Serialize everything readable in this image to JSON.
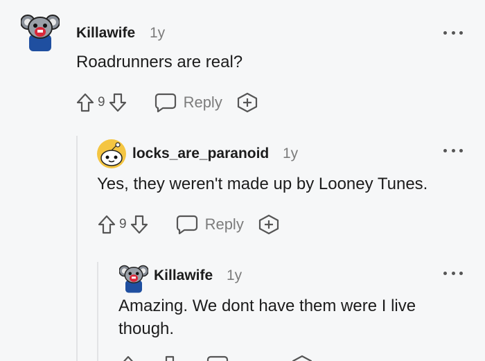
{
  "comments": [
    {
      "username": "Killawife",
      "age": "1y",
      "text": "Roadrunners are real?",
      "score": "9",
      "reply_label": "Reply",
      "avatar": "koala-avatar-icon"
    },
    {
      "username": "locks_are_paranoid",
      "age": "1y",
      "text": "Yes, they weren't made up by Looney Tunes.",
      "score": "9",
      "reply_label": "Reply",
      "avatar": "yellow-snoo-avatar-icon"
    },
    {
      "username": "Killawife",
      "age": "1y",
      "text": "Amazing. We dont have them were I live though.",
      "avatar": "koala-avatar-icon"
    }
  ],
  "colors": {
    "background": "#f6f7f8",
    "text": "#1c1c1c",
    "muted": "#7c7c7c",
    "icon": "#555555"
  }
}
